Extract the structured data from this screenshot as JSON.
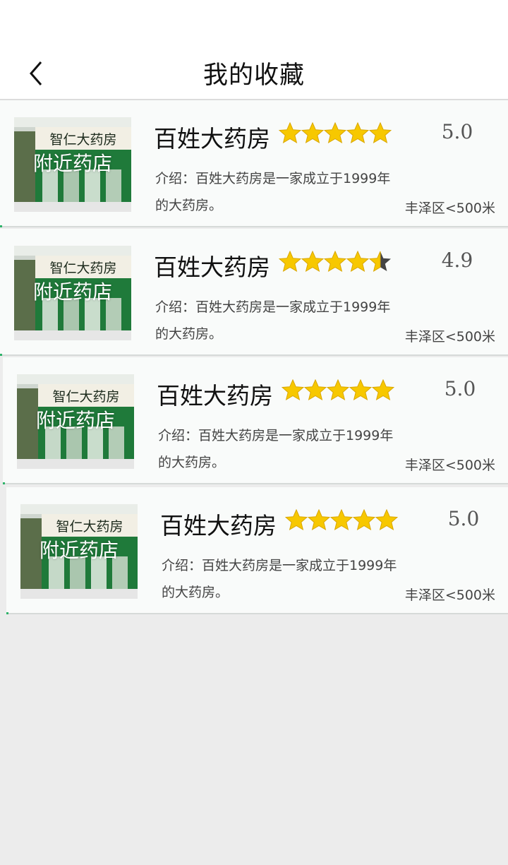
{
  "header": {
    "title": "我的收藏",
    "back_icon": "chevron-left-icon"
  },
  "favorites": [
    {
      "name": "百姓大药房",
      "thumb_label": "附近药店",
      "sign_text": "智仁大药房",
      "rating": 5.0,
      "rating_text": "5.0",
      "intro": "介绍：百姓大药房是一家成立于1999年的大药房。",
      "distance": "丰泽区<500米"
    },
    {
      "name": "百姓大药房",
      "thumb_label": "附近药店",
      "sign_text": "智仁大药房",
      "rating": 4.9,
      "rating_text": "4.9",
      "intro": "介绍：百姓大药房是一家成立于1999年的大药房。",
      "distance": "丰泽区<500米"
    },
    {
      "name": "百姓大药房",
      "thumb_label": "附近药店",
      "sign_text": "智仁大药房",
      "rating": 5.0,
      "rating_text": "5.0",
      "intro": "介绍：百姓大药房是一家成立于1999年的大药房。",
      "distance": "丰泽区<500米"
    },
    {
      "name": "百姓大药房",
      "thumb_label": "附近药店",
      "sign_text": "智仁大药房",
      "rating": 5.0,
      "rating_text": "5.0",
      "intro": "介绍：百姓大药房是一家成立于1999年的大药房。",
      "distance": "丰泽区<500米"
    }
  ],
  "colors": {
    "star": "#f7c800",
    "star_empty": "#444444",
    "sign_green": "#1f7a3a"
  }
}
